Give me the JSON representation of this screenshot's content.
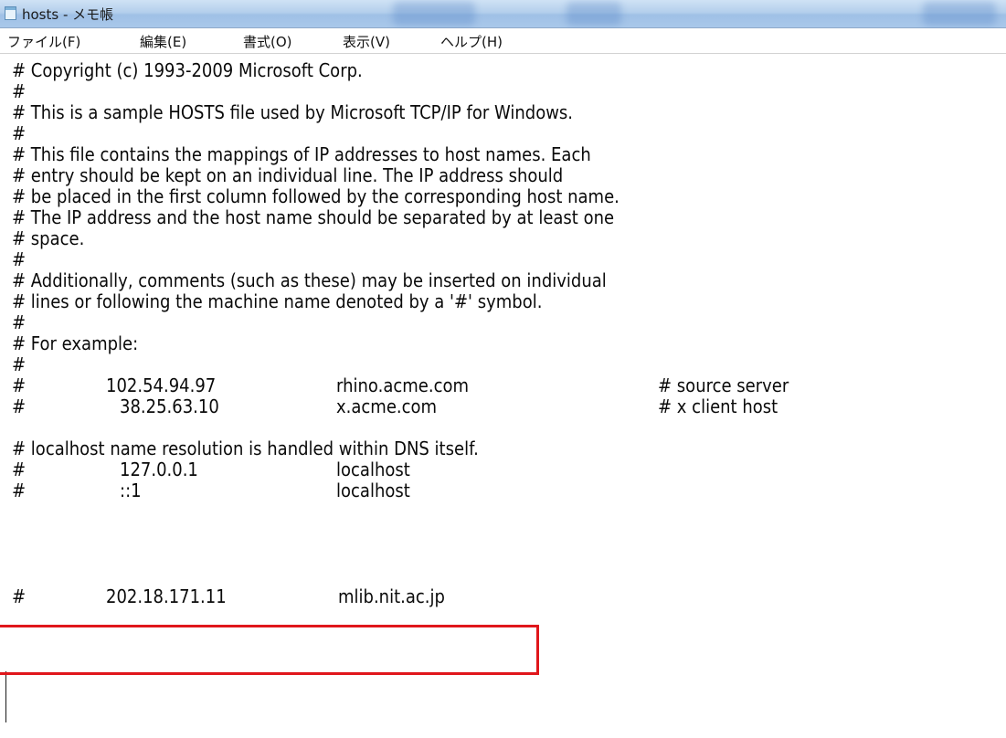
{
  "window": {
    "title": "hosts - メモ帳"
  },
  "menu": [
    {
      "label": "ファイル(F)"
    },
    {
      "label": "編集(E)"
    },
    {
      "label": "書式(O)"
    },
    {
      "label": "表示(V)"
    },
    {
      "label": "ヘルプ(H)"
    }
  ],
  "file": {
    "lines": [
      "# Copyright (c) 1993-2009 Microsoft Corp.",
      "#",
      "# This is a sample HOSTS file used by Microsoft TCP/IP for Windows.",
      "#",
      "# This file contains the mappings of IP addresses to host names. Each",
      "# entry should be kept on an individual line. The IP address should",
      "# be placed in the first column followed by the corresponding host name.",
      "# The IP address and the host name should be separated by at least one",
      "# space.",
      "#",
      "# Additionally, comments (such as these) may be inserted on individual",
      "# lines or following the machine name denoted by a '#' symbol.",
      "#",
      "# For example:",
      "#"
    ],
    "examples": [
      {
        "hash": "#",
        "ip": "102.54.94.97",
        "host": "rhino.acme.com",
        "comment": "# source server"
      },
      {
        "hash": "#",
        "ip": "38.25.63.10",
        "host": "x.acme.com",
        "comment": "# x client host"
      }
    ],
    "localhost_comment": "# localhost name resolution is handled within DNS itself.",
    "mappings": [
      {
        "hash": "#",
        "ip": "127.0.0.1",
        "host": "localhost"
      },
      {
        "hash": "#",
        "ip": "::1",
        "host": "localhost"
      },
      {
        "hash": "#",
        "ip": "202.18.171.11",
        "host": "mlib.nit.ac.jp"
      }
    ]
  },
  "colors": {
    "highlight_box": "#e0161b",
    "titlebar": "#b4cfec"
  }
}
